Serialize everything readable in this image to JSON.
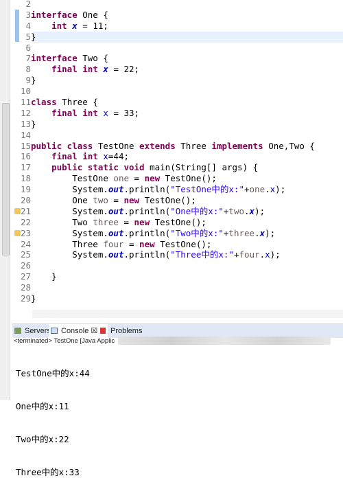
{
  "editor": {
    "lines": [
      {
        "n": "2",
        "t": []
      },
      {
        "n": "3",
        "t": [
          [
            "k",
            "interface"
          ],
          [
            "t",
            " One {"
          ]
        ]
      },
      {
        "n": "4",
        "t": [
          [
            "t",
            "    "
          ],
          [
            "k",
            "int"
          ],
          [
            "t",
            " "
          ],
          [
            "fs",
            "x"
          ],
          [
            "t",
            " = 11;"
          ]
        ]
      },
      {
        "n": "5",
        "t": [
          [
            "t",
            "}"
          ]
        ]
      },
      {
        "n": "6",
        "t": []
      },
      {
        "n": "7",
        "t": [
          [
            "k",
            "interface"
          ],
          [
            "t",
            " Two {"
          ]
        ]
      },
      {
        "n": "8",
        "t": [
          [
            "t",
            "    "
          ],
          [
            "k",
            "final int"
          ],
          [
            "t",
            " "
          ],
          [
            "fs",
            "x"
          ],
          [
            "t",
            " = 22;"
          ]
        ]
      },
      {
        "n": "9",
        "t": [
          [
            "t",
            "}"
          ]
        ]
      },
      {
        "n": "10",
        "t": []
      },
      {
        "n": "11",
        "t": [
          [
            "k",
            "class"
          ],
          [
            "t",
            " Three {"
          ]
        ]
      },
      {
        "n": "12",
        "t": [
          [
            "t",
            "    "
          ],
          [
            "k",
            "final int"
          ],
          [
            "t",
            " "
          ],
          [
            "f",
            "x"
          ],
          [
            "t",
            " = 33;"
          ]
        ]
      },
      {
        "n": "13",
        "t": [
          [
            "t",
            "}"
          ]
        ]
      },
      {
        "n": "14",
        "t": []
      },
      {
        "n": "15",
        "t": [
          [
            "k",
            "public class"
          ],
          [
            "t",
            " TestOne "
          ],
          [
            "k",
            "extends"
          ],
          [
            "t",
            " Three "
          ],
          [
            "k",
            "implements"
          ],
          [
            "t",
            " One,Two {"
          ]
        ]
      },
      {
        "n": "16",
        "t": [
          [
            "t",
            "    "
          ],
          [
            "k",
            "final int"
          ],
          [
            "t",
            " "
          ],
          [
            "f",
            "x"
          ],
          [
            "t",
            "=44;"
          ]
        ]
      },
      {
        "n": "17",
        "t": [
          [
            "t",
            "    "
          ],
          [
            "k",
            "public static void"
          ],
          [
            "t",
            " main(String[] args) {"
          ]
        ]
      },
      {
        "n": "18",
        "t": [
          [
            "t",
            "        TestOne "
          ],
          [
            "l",
            "one"
          ],
          [
            "t",
            " = "
          ],
          [
            "k",
            "new"
          ],
          [
            "t",
            " TestOne();"
          ]
        ]
      },
      {
        "n": "19",
        "t": [
          [
            "t",
            "        System."
          ],
          [
            "fs",
            "out"
          ],
          [
            "t",
            ".println("
          ],
          [
            "s",
            "\"TestOne中的x:\""
          ],
          [
            "t",
            "+"
          ],
          [
            "l",
            "one"
          ],
          [
            "t",
            "."
          ],
          [
            "f",
            "x"
          ],
          [
            "t",
            ");"
          ]
        ]
      },
      {
        "n": "20",
        "t": [
          [
            "t",
            "        One "
          ],
          [
            "l",
            "two"
          ],
          [
            "t",
            " = "
          ],
          [
            "k",
            "new"
          ],
          [
            "t",
            " TestOne();"
          ]
        ]
      },
      {
        "n": "21",
        "w": true,
        "t": [
          [
            "t",
            "        System."
          ],
          [
            "fs",
            "out"
          ],
          [
            "t",
            ".println("
          ],
          [
            "s",
            "\"One中的x:\""
          ],
          [
            "t",
            "+"
          ],
          [
            "l",
            "two"
          ],
          [
            "t",
            "."
          ],
          [
            "fs",
            "x"
          ],
          [
            "t",
            ");"
          ]
        ]
      },
      {
        "n": "22",
        "t": [
          [
            "t",
            "        Two "
          ],
          [
            "l",
            "three"
          ],
          [
            "t",
            " = "
          ],
          [
            "k",
            "new"
          ],
          [
            "t",
            " TestOne();"
          ]
        ]
      },
      {
        "n": "23",
        "w": true,
        "t": [
          [
            "t",
            "        System."
          ],
          [
            "fs",
            "out"
          ],
          [
            "t",
            ".println("
          ],
          [
            "s",
            "\"Two中的x:\""
          ],
          [
            "t",
            "+"
          ],
          [
            "l",
            "three"
          ],
          [
            "t",
            "."
          ],
          [
            "fs",
            "x"
          ],
          [
            "t",
            ");"
          ]
        ]
      },
      {
        "n": "24",
        "t": [
          [
            "t",
            "        Three "
          ],
          [
            "l",
            "four"
          ],
          [
            "t",
            " = "
          ],
          [
            "k",
            "new"
          ],
          [
            "t",
            " TestOne();"
          ]
        ]
      },
      {
        "n": "25",
        "t": [
          [
            "t",
            "        System."
          ],
          [
            "fs",
            "out"
          ],
          [
            "t",
            ".println("
          ],
          [
            "s",
            "\"Three中的x:\""
          ],
          [
            "t",
            "+"
          ],
          [
            "l",
            "four"
          ],
          [
            "t",
            "."
          ],
          [
            "f",
            "x"
          ],
          [
            "t",
            ");"
          ]
        ]
      },
      {
        "n": "26",
        "t": []
      },
      {
        "n": "27",
        "t": [
          [
            "t",
            "    }"
          ]
        ]
      },
      {
        "n": "28",
        "t": []
      },
      {
        "n": "29",
        "t": [
          [
            "t",
            "}"
          ]
        ]
      }
    ]
  },
  "panel": {
    "tabs": [
      {
        "label": "Servers",
        "icon": "servers-icon"
      },
      {
        "label": "Console ☒",
        "icon": "console-icon"
      },
      {
        "label": "Problems",
        "icon": "problems-icon"
      }
    ],
    "terminated": "<terminated> TestOne [Java Applic",
    "output": [
      "TestOne中的x:44",
      "One中的x:11",
      "Two中的x:22",
      "Three中的x:33"
    ]
  }
}
